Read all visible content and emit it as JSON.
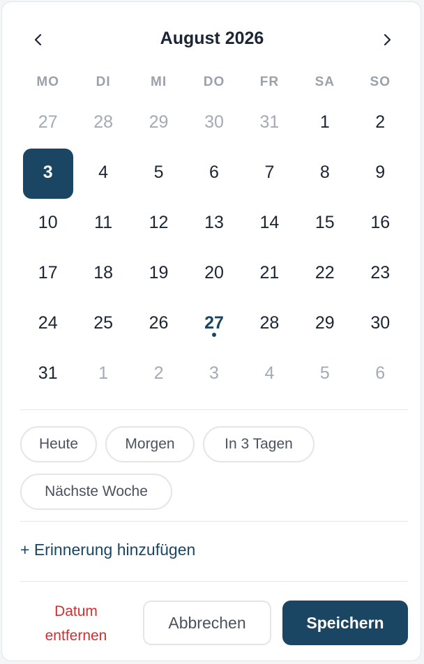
{
  "colors": {
    "accent": "#1b4663",
    "danger": "#d02f2f",
    "text": "#1c2533",
    "muted": "#a4aab3",
    "border": "#e3e5e8"
  },
  "header": {
    "prev_icon": "chevron-left-icon",
    "title": "August 2026",
    "next_icon": "chevron-right-icon"
  },
  "weekdays": [
    "MO",
    "DI",
    "MI",
    "DO",
    "FR",
    "SA",
    "SO"
  ],
  "days": [
    {
      "label": "27",
      "muted": true
    },
    {
      "label": "28",
      "muted": true
    },
    {
      "label": "29",
      "muted": true
    },
    {
      "label": "30",
      "muted": true
    },
    {
      "label": "31",
      "muted": true
    },
    {
      "label": "1"
    },
    {
      "label": "2"
    },
    {
      "label": "3",
      "selected": true
    },
    {
      "label": "4"
    },
    {
      "label": "5"
    },
    {
      "label": "6"
    },
    {
      "label": "7"
    },
    {
      "label": "8"
    },
    {
      "label": "9"
    },
    {
      "label": "10"
    },
    {
      "label": "11"
    },
    {
      "label": "12"
    },
    {
      "label": "13"
    },
    {
      "label": "14"
    },
    {
      "label": "15"
    },
    {
      "label": "16"
    },
    {
      "label": "17"
    },
    {
      "label": "18"
    },
    {
      "label": "19"
    },
    {
      "label": "20"
    },
    {
      "label": "21"
    },
    {
      "label": "22"
    },
    {
      "label": "23"
    },
    {
      "label": "24"
    },
    {
      "label": "25"
    },
    {
      "label": "26"
    },
    {
      "label": "27",
      "today": true
    },
    {
      "label": "28"
    },
    {
      "label": "29"
    },
    {
      "label": "30"
    },
    {
      "label": "31"
    },
    {
      "label": "1",
      "muted": true
    },
    {
      "label": "2",
      "muted": true
    },
    {
      "label": "3",
      "muted": true
    },
    {
      "label": "4",
      "muted": true
    },
    {
      "label": "5",
      "muted": true
    },
    {
      "label": "6",
      "muted": true
    }
  ],
  "quick_picks": [
    "Heute",
    "Morgen",
    "In 3 Tagen",
    "Nächste Woche"
  ],
  "reminder_label": "+ Erinnerung hinzufügen",
  "footer": {
    "remove_line1": "Datum",
    "remove_line2": "entfernen",
    "cancel_label": "Abbrechen",
    "save_label": "Speichern"
  }
}
